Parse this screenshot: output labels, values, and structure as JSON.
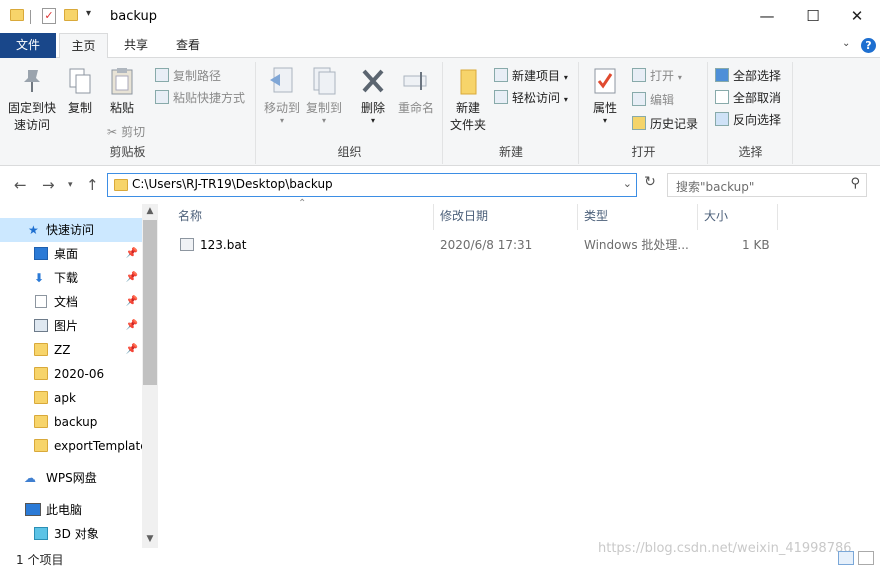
{
  "window": {
    "title": "backup",
    "minimize": "—",
    "maximize": "☐",
    "close": "✕"
  },
  "ribbon_tabs": {
    "file": "文件",
    "home": "主页",
    "share": "共享",
    "view": "查看"
  },
  "ribbon": {
    "clipboard": {
      "label": "剪贴板",
      "pin_quick_access": "固定到快\n速访问",
      "pin_line1": "固定到快",
      "pin_line2": "速访问",
      "copy": "复制",
      "paste": "粘贴",
      "copy_path": "复制路径",
      "paste_shortcut": "粘贴快捷方式",
      "cut": "剪切"
    },
    "organize": {
      "label": "组织",
      "move_to": "移动到",
      "copy_to": "复制到",
      "delete": "删除",
      "rename": "重命名"
    },
    "new": {
      "label": "新建",
      "new_folder_line1": "新建",
      "new_folder_line2": "文件夹",
      "new_item": "新建项目",
      "easy_access": "轻松访问"
    },
    "open": {
      "label": "打开",
      "properties": "属性",
      "open": "打开",
      "edit": "编辑",
      "history": "历史记录"
    },
    "select": {
      "label": "选择",
      "select_all": "全部选择",
      "select_none": "全部取消",
      "invert": "反向选择"
    }
  },
  "address": {
    "path": "C:\\Users\\RJ-TR19\\Desktop\\backup",
    "search_placeholder": "搜索\"backup\""
  },
  "nav": {
    "quick_access": "快速访问",
    "items": [
      {
        "label": "桌面",
        "pinned": true,
        "icon": "desktop-icon"
      },
      {
        "label": "下载",
        "pinned": true,
        "icon": "download-icon"
      },
      {
        "label": "文档",
        "pinned": true,
        "icon": "document-icon"
      },
      {
        "label": "图片",
        "pinned": true,
        "icon": "picture-icon"
      },
      {
        "label": "ZZ",
        "pinned": true,
        "icon": "folder-icon"
      },
      {
        "label": "2020-06",
        "pinned": false,
        "icon": "folder-icon"
      },
      {
        "label": "apk",
        "pinned": false,
        "icon": "folder-icon"
      },
      {
        "label": "backup",
        "pinned": false,
        "icon": "folder-icon"
      },
      {
        "label": "exportTemplate",
        "pinned": false,
        "icon": "folder-icon"
      }
    ],
    "wps": "WPS网盘",
    "this_pc": "此电脑",
    "objects_3d": "3D 对象"
  },
  "columns": {
    "name": "名称",
    "modified": "修改日期",
    "type": "类型",
    "size": "大小"
  },
  "files": [
    {
      "name": "123.bat",
      "modified": "2020/6/8 17:31",
      "type": "Windows 批处理...",
      "size": "1 KB",
      "icon": "bat-file-icon"
    }
  ],
  "status": {
    "count": "1 个项目"
  },
  "watermark": "https://blog.csdn.net/weixin_41998786",
  "colors": {
    "file_tab": "#19478a",
    "selection": "#cce8ff",
    "address_border": "#3d8ee4",
    "folder": "#f7d46a"
  }
}
